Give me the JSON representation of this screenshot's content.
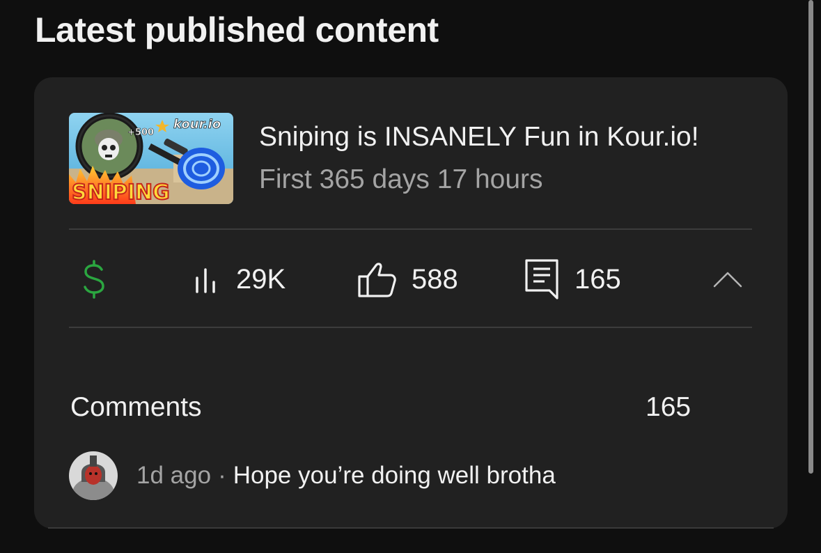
{
  "section": {
    "title": "Latest published content"
  },
  "video": {
    "title": "Sniping is INSANELY Fun in Kour.io!",
    "subtitle": "First 365 days 17 hours",
    "thumbnail": {
      "badge": "+500",
      "brand": "kour.io",
      "caption": "SNIPING"
    }
  },
  "stats": {
    "monetization_icon": "dollar-icon",
    "views": "29K",
    "likes": "588",
    "comments": "165",
    "accent_green": "#2ba640"
  },
  "comments": {
    "label": "Comments",
    "count": "165",
    "latest": {
      "time": "1d ago",
      "separator": "·",
      "text": "Hope you’re doing well brotha"
    }
  }
}
